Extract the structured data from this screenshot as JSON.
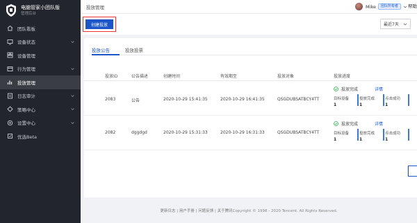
{
  "brand": {
    "title": "电脑管家小团队版",
    "subtitle": "管理后台"
  },
  "sidebar": {
    "items": [
      {
        "label": "团队看板",
        "icon": "home-icon",
        "chevron": false,
        "active": false
      },
      {
        "label": "设备状态",
        "icon": "monitor-icon",
        "chevron": true,
        "active": false
      },
      {
        "label": "设备管理",
        "icon": "device-icon",
        "chevron": false,
        "active": false
      },
      {
        "label": "行为管理",
        "icon": "behavior-icon",
        "chevron": true,
        "active": false
      },
      {
        "label": "投放管理",
        "icon": "chart-icon",
        "chevron": false,
        "active": true
      },
      {
        "label": "日志审计",
        "icon": "log-icon",
        "chevron": true,
        "active": false
      },
      {
        "label": "策略中心",
        "icon": "policy-icon",
        "chevron": true,
        "active": false
      },
      {
        "label": "设置中心",
        "icon": "gear-icon",
        "chevron": true,
        "active": false
      },
      {
        "label": "优选Beta",
        "icon": "star-icon",
        "chevron": false,
        "active": false
      }
    ]
  },
  "header": {
    "breadcrumb": "投放管理",
    "user_name": "Mike",
    "role_badge": "团队所有者",
    "help": "帮助"
  },
  "toolbar": {
    "create_label": "创建投放",
    "range_label": "最近7天"
  },
  "tabs": [
    {
      "label": "投放公告",
      "active": true
    },
    {
      "label": "投放投票",
      "active": false
    }
  ],
  "table": {
    "headers": [
      "投放ID",
      "公告描述",
      "创建时间",
      "有效期至",
      "投放对象",
      "投放进度"
    ],
    "rows": [
      {
        "id": "2083",
        "desc": "公告",
        "created": "2020-10-29 15:41:35",
        "expires": "2020-10-29 16:41:35",
        "target": "QSGDUBSATBCY4TT",
        "status": "投放完成",
        "detail": "详情",
        "stats": [
          {
            "label": "目标设备",
            "value": "1"
          },
          {
            "label": "投放完成",
            "value": "1"
          },
          {
            "label": "点击成功",
            "value": "1"
          }
        ]
      },
      {
        "id": "2082",
        "desc": "dggdgd",
        "created": "2020-10-29 15:31:33",
        "expires": "2020-10-29 16:31:33",
        "target": "QSGDUBSATBCY4TT",
        "status": "投放完成",
        "detail": "详情",
        "stats": [
          {
            "label": "目标设备",
            "value": "1"
          },
          {
            "label": "投放完成",
            "value": "1"
          },
          {
            "label": "点击成功",
            "value": "1"
          }
        ]
      }
    ]
  },
  "pager": {
    "prev": "<"
  },
  "footer": {
    "links": [
      "更新日志",
      "用户手册",
      "问题反馈",
      "关于腾讯"
    ],
    "copyright": "Copyright © 1998 - 2020 Tencent. All Rights Reserved."
  },
  "colors": {
    "sidebar_bg": "#22252b",
    "accent": "#1b55c8",
    "success": "#2bb34a",
    "highlight_box": "#ee3333"
  }
}
